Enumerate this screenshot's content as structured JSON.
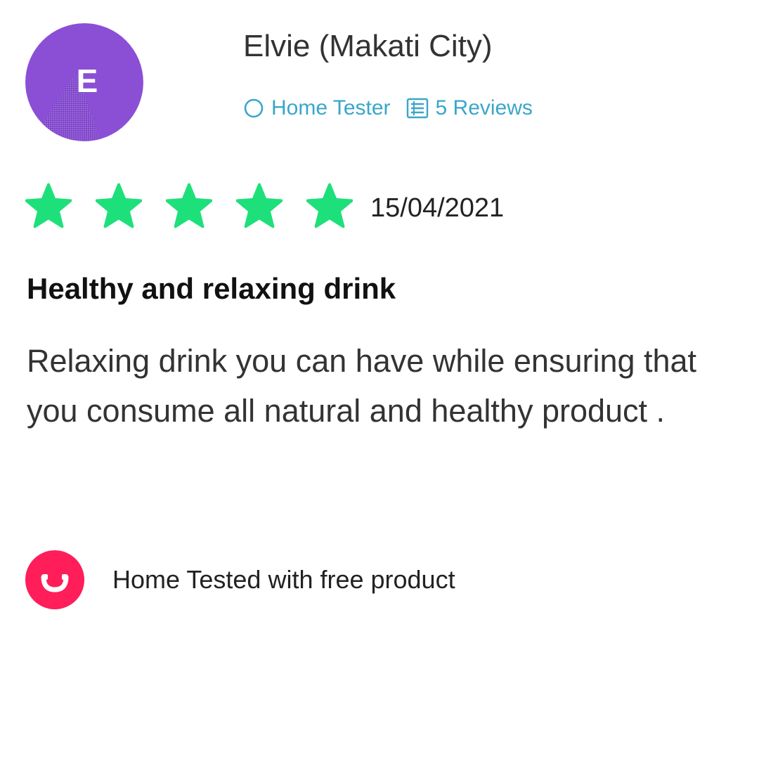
{
  "reviewer": {
    "initial": "E",
    "name": "Elvie",
    "location": "(Makati City)",
    "badge": "Home Tester",
    "reviews_count": "5 Reviews",
    "avatar_color": "#8b4fd6"
  },
  "rating": {
    "stars": 5,
    "max": 5,
    "date": "15/04/2021",
    "star_color": "#1ee07a"
  },
  "review": {
    "title": "Healthy and relaxing drink",
    "body": "Relaxing drink you can have while ensuring that you consume all natural and healthy product ."
  },
  "footer": {
    "tested_label": "Home Tested with free product",
    "tested_icon": "smile-badge-icon",
    "tested_color": "#ff1e5a"
  },
  "icons": {
    "badge": "circle-outline-icon",
    "reviews": "list-document-icon"
  },
  "accent_color": "#3aa6c9"
}
